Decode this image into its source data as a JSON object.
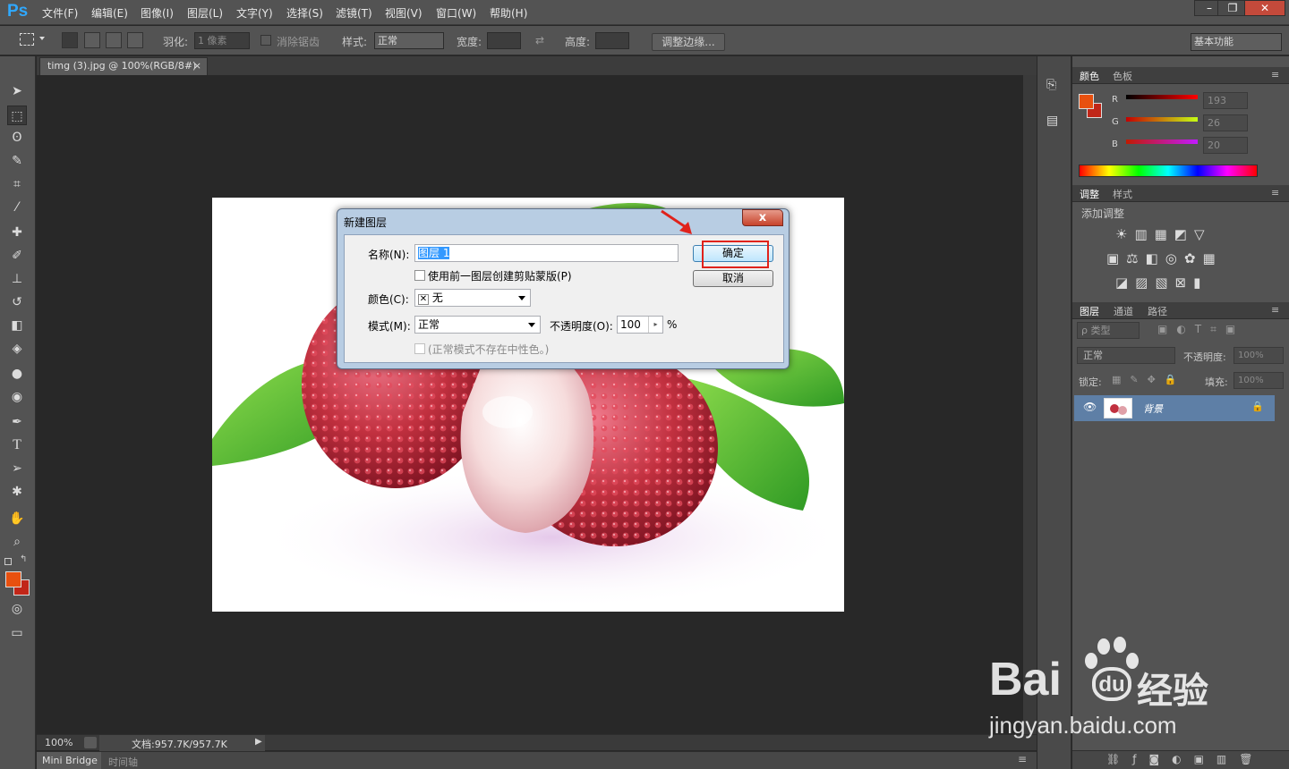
{
  "app": {
    "logo": "Ps"
  },
  "menu": [
    "文件(F)",
    "编辑(E)",
    "图像(I)",
    "图层(L)",
    "文字(Y)",
    "选择(S)",
    "滤镜(T)",
    "视图(V)",
    "窗口(W)",
    "帮助(H)"
  ],
  "window_controls": {
    "minimize": "–",
    "restore": "❐",
    "close": "✕"
  },
  "options_bar": {
    "feather_label": "羽化:",
    "feather_value": "1 像素",
    "antialias_label": "消除锯齿",
    "style_label": "样式:",
    "style_value": "正常",
    "width_label": "宽度:",
    "height_label": "高度:",
    "refine_edge_button": "调整边缘...",
    "workspace_value": "基本功能"
  },
  "document_tab": {
    "title": "timg (3).jpg @ 100%(RGB/8#)",
    "close": "×"
  },
  "dialog": {
    "title": "新建图层",
    "name_label": "名称(N):",
    "name_value": "图层 1",
    "clip_checkbox_label": "使用前一图层创建剪贴蒙版(P)",
    "color_label": "颜色(C):",
    "color_value": "无",
    "mode_label": "模式(M):",
    "mode_value": "正常",
    "opacity_label": "不透明度(O):",
    "opacity_value": "100",
    "opacity_unit": "%",
    "neutral_checkbox_label": "(正常模式不存在中性色。)",
    "ok_button": "确定",
    "cancel_button": "取消",
    "close_glyph": "x"
  },
  "color_panel": {
    "tabs": [
      "颜色",
      "色板"
    ],
    "r_label": "R",
    "g_label": "G",
    "b_label": "B",
    "r_value": "193",
    "g_value": "26",
    "b_value": "20",
    "foreground": "#e8500f",
    "background": "#c12618"
  },
  "adjust_panel": {
    "tabs": [
      "调整",
      "样式"
    ],
    "heading": "添加调整"
  },
  "layers_panel": {
    "tabs": [
      "图层",
      "通道",
      "路径"
    ],
    "filter_label": "ρ 类型",
    "blend_mode": "正常",
    "opacity_label": "不透明度:",
    "opacity_value": "100%",
    "lock_label": "锁定:",
    "fill_label": "填充:",
    "fill_value": "100%",
    "layers": [
      {
        "name": "背景"
      }
    ]
  },
  "status_bar": {
    "zoom": "100%",
    "doc_info": "文档:957.7K/957.7K"
  },
  "bottom_tabs": [
    "Mini Bridge",
    "时间轴"
  ],
  "watermark": {
    "brand": "Bai",
    "brand_du": "du",
    "jingyan": "经验",
    "url": "jingyan.baidu.com"
  }
}
